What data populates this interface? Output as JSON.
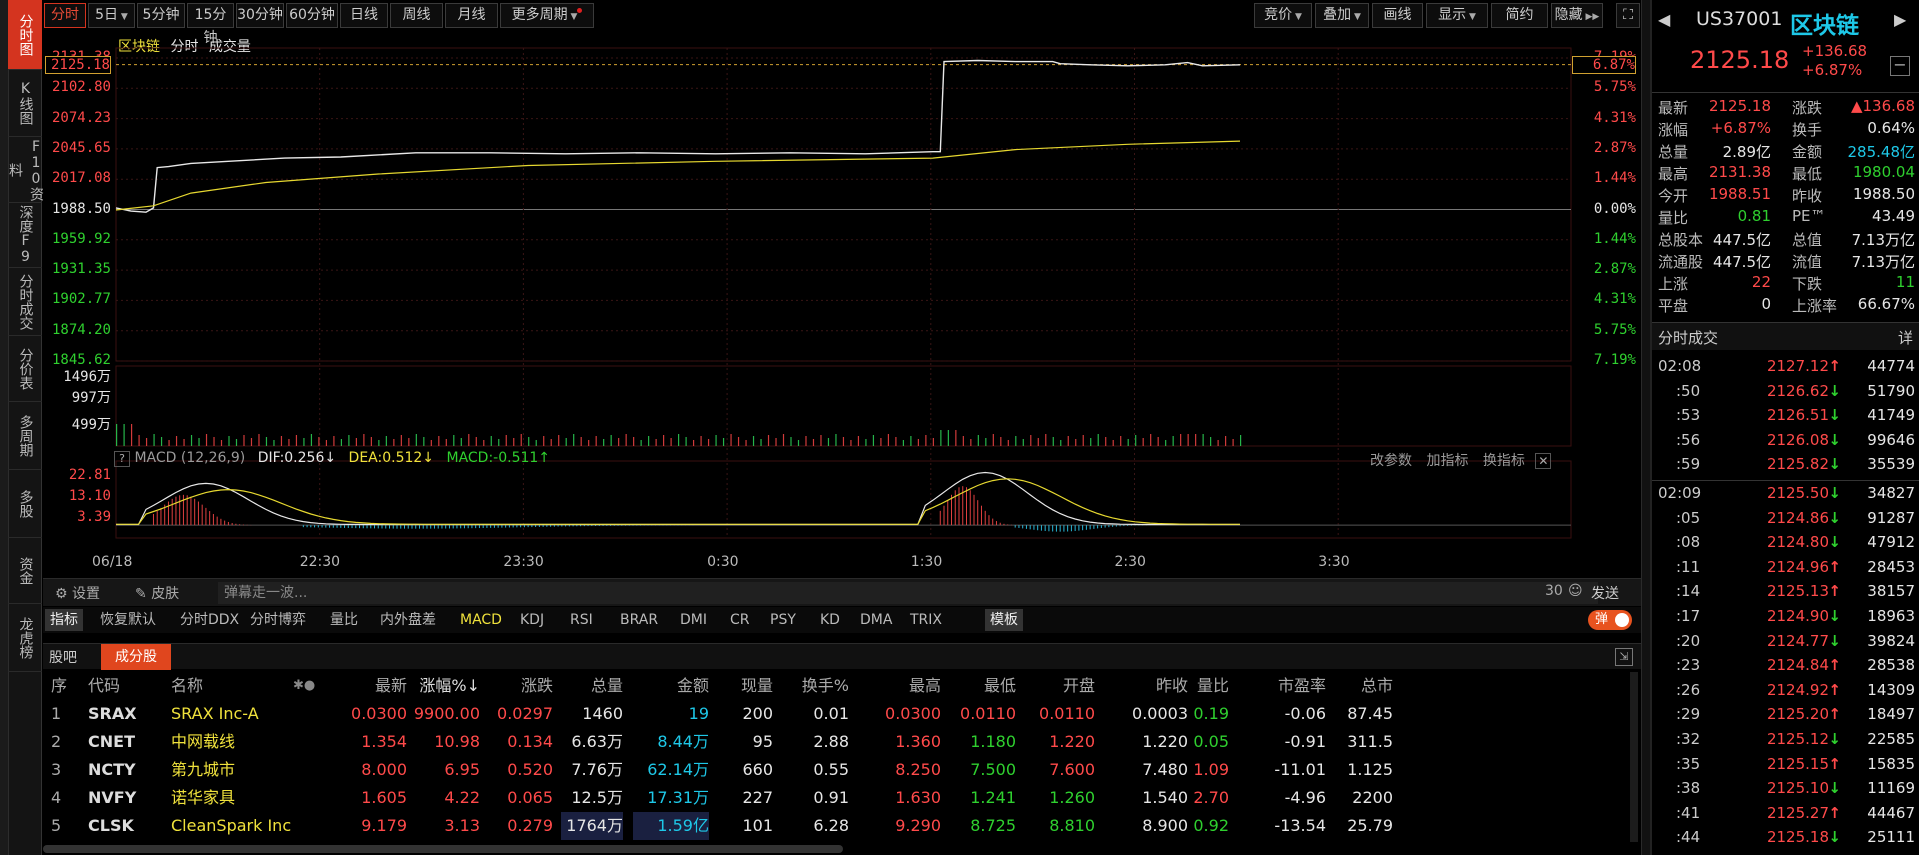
{
  "left_nav": [
    {
      "label": "分时图",
      "active": true
    },
    {
      "label": "K线图",
      "active": false
    },
    {
      "label": "F10资料",
      "active": false
    },
    {
      "label": "深度F9",
      "active": false
    },
    {
      "label": "分时成交",
      "active": false
    },
    {
      "label": "分价表",
      "active": false
    },
    {
      "label": "多周期",
      "active": false
    },
    {
      "label": "多股",
      "active": false
    },
    {
      "label": "资金",
      "active": false
    },
    {
      "label": "龙虎榜",
      "active": false
    }
  ],
  "toolbar": {
    "periods": [
      "分时",
      "5日",
      "5分钟",
      "15分钟",
      "30分钟",
      "60分钟",
      "日线",
      "周线",
      "月线",
      "更多周期"
    ],
    "right": [
      "竞价",
      "叠加",
      "画线",
      "显示",
      "简约",
      "隐藏"
    ]
  },
  "chart_header": {
    "name": "区块链",
    "mode": "分时",
    "volume": "成交量"
  },
  "chart_data": {
    "type": "line",
    "prev_close": 1988.5,
    "ylim": [
      1845.62,
      2131.38
    ],
    "left_ticks": [
      {
        "v": "2131.38",
        "c": "red"
      },
      {
        "v": "2102.80",
        "c": "red"
      },
      {
        "v": "2074.23",
        "c": "red"
      },
      {
        "v": "2045.65",
        "c": "red"
      },
      {
        "v": "2017.08",
        "c": "red"
      },
      {
        "v": "1988.50",
        "c": "white"
      },
      {
        "v": "1959.92",
        "c": "green"
      },
      {
        "v": "1931.35",
        "c": "green"
      },
      {
        "v": "1902.77",
        "c": "green"
      },
      {
        "v": "1874.20",
        "c": "green"
      },
      {
        "v": "1845.62",
        "c": "green"
      }
    ],
    "right_ticks": [
      {
        "v": "7.19%",
        "c": "red"
      },
      {
        "v": "5.75%",
        "c": "red"
      },
      {
        "v": "4.31%",
        "c": "red"
      },
      {
        "v": "2.87%",
        "c": "red"
      },
      {
        "v": "1.44%",
        "c": "red"
      },
      {
        "v": "0.00%",
        "c": "white"
      },
      {
        "v": "1.44%",
        "c": "green"
      },
      {
        "v": "2.87%",
        "c": "green"
      },
      {
        "v": "4.31%",
        "c": "green"
      },
      {
        "v": "5.75%",
        "c": "green"
      },
      {
        "v": "7.19%",
        "c": "green"
      }
    ],
    "current_price": "2125.18",
    "current_pct": "6.87%",
    "x_labels": [
      "06/18",
      "22:30",
      "23:30",
      "0:30",
      "1:30",
      "2:30",
      "3:30"
    ],
    "price_points": [
      [
        0,
        1990
      ],
      [
        4,
        1987
      ],
      [
        8,
        1986
      ],
      [
        10,
        1990
      ],
      [
        11,
        2028
      ],
      [
        14,
        2029
      ],
      [
        20,
        2032
      ],
      [
        30,
        2034
      ],
      [
        45,
        2037
      ],
      [
        60,
        2038
      ],
      [
        80,
        2042
      ],
      [
        100,
        2042
      ],
      [
        120,
        2041
      ],
      [
        140,
        2042
      ],
      [
        160,
        2041
      ],
      [
        180,
        2042
      ],
      [
        200,
        2041
      ],
      [
        218,
        2043
      ],
      [
        220,
        2043
      ],
      [
        221,
        2128
      ],
      [
        230,
        2129
      ],
      [
        240,
        2128
      ],
      [
        250,
        2128
      ],
      [
        252,
        2126
      ],
      [
        260,
        2125
      ],
      [
        270,
        2124
      ],
      [
        280,
        2125
      ],
      [
        286,
        2127
      ],
      [
        290,
        2124
      ],
      [
        300,
        2125
      ]
    ],
    "avg_points": [
      [
        0,
        1988
      ],
      [
        10,
        1992
      ],
      [
        20,
        2004
      ],
      [
        40,
        2014
      ],
      [
        70,
        2022
      ],
      [
        110,
        2030
      ],
      [
        160,
        2034
      ],
      [
        218,
        2037
      ],
      [
        240,
        2045
      ],
      [
        270,
        2050
      ],
      [
        300,
        2053
      ]
    ],
    "total_minutes": 390,
    "volume_ticks": [
      "1496万",
      "997万",
      "499万"
    ],
    "volume_ymax": 1496,
    "macd": {
      "label": "MACD (12,26,9)",
      "dif": "DIF:0.256↓",
      "dea": "DEA:0.512↓",
      "macd": "MACD:-0.511↑",
      "ticks": [
        "22.81",
        "13.10",
        "3.39"
      ],
      "ylim": [
        -5,
        25
      ],
      "actions": [
        "改参数",
        "加指标",
        "换指标"
      ]
    }
  },
  "bottom_bar": {
    "settings": "设置",
    "skin": "皮肤",
    "danmu_placeholder": "弹幕走一波...",
    "count": "30",
    "send": "发送"
  },
  "indicator_tabs": [
    "指标",
    "恢复默认",
    "分时DDX",
    "分时博弈",
    "量比",
    "内外盘差",
    "MACD",
    "KDJ",
    "RSI",
    "BRAR",
    "DMI",
    "CR",
    "PSY",
    "KD",
    "DMA",
    "TRIX",
    "模板"
  ],
  "danmu_toggle": "弹",
  "list_tabs": [
    "股吧",
    "成分股"
  ],
  "table": {
    "headers": [
      "序",
      "代码",
      "名称",
      "最新",
      "涨幅%↓",
      "涨跌",
      "总量",
      "金额",
      "现量",
      "换手%",
      "最高",
      "最低",
      "开盘",
      "昨收",
      "量比",
      "市盈率",
      "总市"
    ],
    "rows": [
      [
        "1",
        "SRAX",
        "SRAX Inc-A",
        "0.0300",
        "9900.00",
        "0.0297",
        "1460",
        "19",
        "200",
        "0.01",
        "0.0300",
        "0.0110",
        "0.0110",
        "0.0003",
        "0.19",
        "-0.06",
        "87.45"
      ],
      [
        "2",
        "CNET",
        "中网载线",
        "1.354",
        "10.98",
        "0.134",
        "6.63万",
        "8.44万",
        "95",
        "2.88",
        "1.360",
        "1.180",
        "1.220",
        "1.220",
        "0.05",
        "-0.91",
        "311.5"
      ],
      [
        "3",
        "NCTY",
        "第九城市",
        "8.000",
        "6.95",
        "0.520",
        "7.76万",
        "62.14万",
        "660",
        "0.55",
        "8.250",
        "7.500",
        "7.600",
        "7.480",
        "1.09",
        "-11.01",
        "1.125"
      ],
      [
        "4",
        "NVFY",
        "诺华家具",
        "1.605",
        "4.22",
        "0.065",
        "12.5万",
        "17.31万",
        "227",
        "0.91",
        "1.630",
        "1.241",
        "1.260",
        "1.540",
        "2.70",
        "-4.96",
        "2200"
      ],
      [
        "5",
        "CLSK",
        "CleanSpark Inc",
        "9.179",
        "3.13",
        "0.279",
        "1764万",
        "1.59亿",
        "101",
        "6.28",
        "9.290",
        "8.725",
        "8.810",
        "8.900",
        "0.92",
        "-13.54",
        "25.79"
      ]
    ]
  },
  "right_panel": {
    "code": "US37001",
    "name": "区块链",
    "price": "2125.18",
    "change": "+136.68",
    "change_pct": "+6.87%",
    "stats": [
      [
        "最新",
        "2125.18",
        "red",
        "涨跌",
        "▲136.68",
        "red"
      ],
      [
        "涨幅",
        "+6.87%",
        "red",
        "换手",
        "0.64%",
        "white"
      ],
      [
        "总量",
        "2.89亿",
        "white",
        "金额",
        "285.48亿",
        "cyan"
      ],
      [
        "最高",
        "2131.38",
        "red",
        "最低",
        "1980.04",
        "green"
      ],
      [
        "今开",
        "1988.51",
        "red",
        "昨收",
        "1988.50",
        "white"
      ],
      [
        "量比",
        "0.81",
        "green",
        "PE™",
        "43.49",
        "white"
      ],
      [
        "总股本",
        "447.5亿",
        "white",
        "总值",
        "7.13万亿",
        "white"
      ],
      [
        "流通股",
        "447.5亿",
        "white",
        "流值",
        "7.13万亿",
        "white"
      ],
      [
        "上涨",
        "22",
        "red",
        "下跌",
        "11",
        "green"
      ],
      [
        "平盘",
        "0",
        "white",
        "上涨率",
        "66.67%",
        "white"
      ]
    ],
    "trades_title": "分时成交",
    "trades_detail": "详",
    "trades": [
      [
        "02:08",
        "2127.12",
        "up",
        "44774"
      ],
      [
        ":50",
        "2126.62",
        "down",
        "51790"
      ],
      [
        ":53",
        "2126.51",
        "down",
        "41749"
      ],
      [
        ":56",
        "2126.08",
        "down",
        "99646"
      ],
      [
        ":59",
        "2125.82",
        "down",
        "35539"
      ],
      [
        "02:09",
        "2125.50",
        "down",
        "34827"
      ],
      [
        ":05",
        "2124.86",
        "down",
        "91287"
      ],
      [
        ":08",
        "2124.80",
        "down",
        "47912"
      ],
      [
        ":11",
        "2124.96",
        "up",
        "28453"
      ],
      [
        ":14",
        "2125.13",
        "up",
        "38157"
      ],
      [
        ":17",
        "2124.90",
        "down",
        "18963"
      ],
      [
        ":20",
        "2124.77",
        "down",
        "39824"
      ],
      [
        ":23",
        "2124.84",
        "up",
        "28538"
      ],
      [
        ":26",
        "2124.92",
        "up",
        "14309"
      ],
      [
        ":29",
        "2125.20",
        "up",
        "18497"
      ],
      [
        ":32",
        "2125.12",
        "down",
        "22585"
      ],
      [
        ":35",
        "2125.15",
        "up",
        "15835"
      ],
      [
        ":38",
        "2125.10",
        "down",
        "11169"
      ],
      [
        ":41",
        "2125.27",
        "up",
        "44467"
      ],
      [
        ":44",
        "2125.18",
        "down",
        "25111"
      ]
    ]
  }
}
